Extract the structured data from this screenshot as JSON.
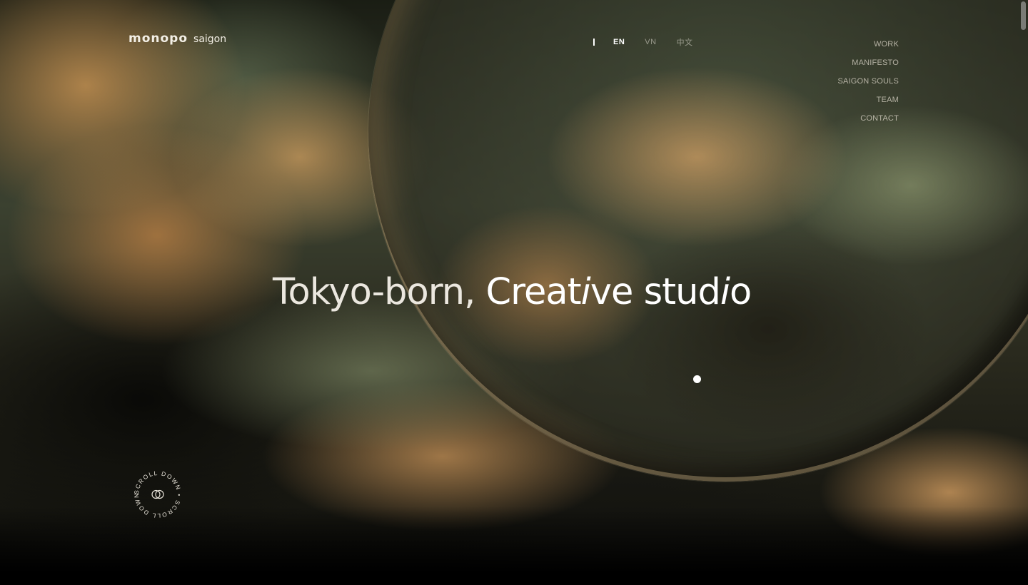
{
  "brand": {
    "name": "monopo",
    "location": "saigon"
  },
  "languages": [
    {
      "label": "EN",
      "active": true
    },
    {
      "label": "VN",
      "active": false
    },
    {
      "label": "中文",
      "active": false
    }
  ],
  "nav": {
    "items": [
      "WORK",
      "MANIFESTO",
      "SAIGON SOULS",
      "TEAM",
      "CONTACT"
    ]
  },
  "hero": {
    "part1": "Tokyo-born, ",
    "part2": "Creat",
    "part3": "i",
    "part4": "ve stud",
    "part5": "i",
    "part6": "o"
  },
  "scroll": {
    "text": "SCROLL DOWN • SCROLL DOWN • "
  },
  "colors": {
    "accent": "#ffffff",
    "warm": "#c8955a",
    "olive": "#5c684e"
  }
}
